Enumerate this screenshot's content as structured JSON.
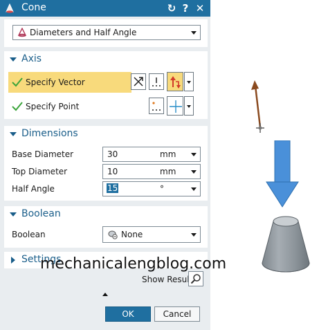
{
  "window": {
    "title": "Cone"
  },
  "type_selector": {
    "value": "Diameters and Half Angle"
  },
  "axis": {
    "header": "Axis",
    "specify_vector_label": "Specify Vector",
    "specify_point_label": "Specify Point"
  },
  "dimensions": {
    "header": "Dimensions",
    "rows": [
      {
        "label": "Base Diameter",
        "value": "30",
        "unit": "mm"
      },
      {
        "label": "Top Diameter",
        "value": "10",
        "unit": "mm"
      },
      {
        "label": "Half Angle",
        "value": "15",
        "unit": "°"
      }
    ]
  },
  "boolean": {
    "header": "Boolean",
    "label": "Boolean",
    "value": "None"
  },
  "settings": {
    "header": "Settings"
  },
  "show_result_label": "Show Result",
  "buttons": {
    "ok": "OK",
    "cancel": "Cancel"
  },
  "watermark": "mechanicalengblog.com",
  "colors": {
    "title_bar": "#1f6fa0",
    "accent_text": "#1a5e8a",
    "highlight_row": "#f8da7c",
    "check": "#3aa43a",
    "vector_stick": "#8a4a1f",
    "big_arrow": "#4a90d9",
    "cone": "#9aa2a8"
  },
  "icons": {
    "app": "cone-icon",
    "reset": "reset-icon",
    "help": "help-icon",
    "close": "close-icon",
    "inferred_vector": "inferred-vector-icon",
    "vector_dialog": "vector-dialog-icon",
    "reverse_direction": "reverse-direction-icon",
    "point_dialog": "point-dialog-icon",
    "point_crosshair": "point-crosshair-icon",
    "boolean_none": "boolean-none-icon",
    "show_result": "magnifier-icon"
  }
}
